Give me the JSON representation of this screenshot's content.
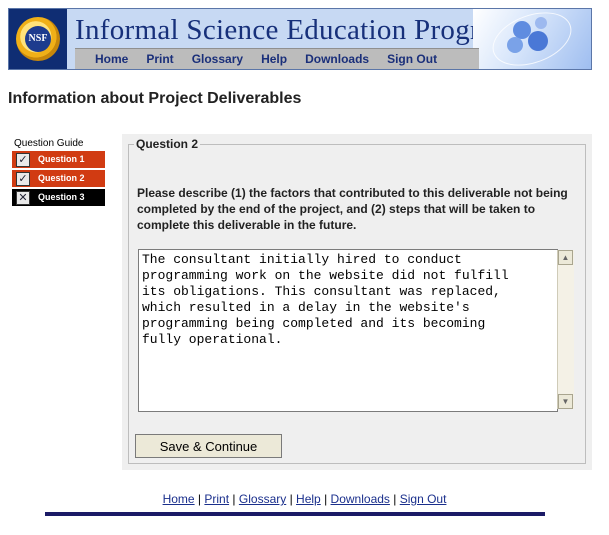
{
  "header": {
    "logo_text": "NSF",
    "title": "Informal Science Education Program",
    "nav": [
      "Home",
      "Print",
      "Glossary",
      "Help",
      "Downloads",
      "Sign Out"
    ]
  },
  "page_title": "Information about Project Deliverables",
  "guide": {
    "label": "Question Guide",
    "items": [
      {
        "label": "Question 1",
        "state": "checked",
        "mark": "✓"
      },
      {
        "label": "Question 2",
        "state": "checked",
        "mark": "✓"
      },
      {
        "label": "Question 3",
        "state": "incomplete",
        "mark": "✕"
      }
    ]
  },
  "question": {
    "legend": "Question 2",
    "prompt": "Please describe (1) the factors that contributed to this deliverable not being completed by the end of the project, and (2) steps that will be taken to complete this deliverable in the future.",
    "answer": "The consultant initially hired to conduct\nprogramming work on the website did not fulfill\nits obligations. This consultant was replaced,\nwhich resulted in a delay in the website's\nprogramming being completed and its becoming\nfully operational.",
    "submit_label": "Save & Continue"
  },
  "footer": {
    "links": [
      "Home",
      "Print",
      "Glossary",
      "Help",
      "Downloads",
      "Sign Out"
    ],
    "separator": "|"
  },
  "colors": {
    "nav_text": "#1a2f7a",
    "guide_done": "#d13b12",
    "guide_pending": "#000000",
    "footer_rule": "#1b1a66"
  }
}
